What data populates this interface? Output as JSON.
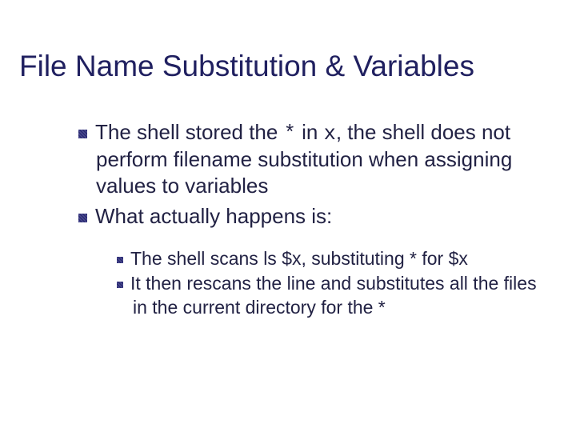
{
  "title": "File Name Substitution & Variables",
  "bullets": {
    "b1a": "The shell stored the ",
    "b1b": " in ",
    "b1c": ", the shell does not perform filename substitution when assigning values to variables",
    "b1_code1": "*",
    "b1_code2": "x",
    "b2": "What actually happens is:",
    "s1a": "The shell scans ls $x, substituting * for $x",
    "s2a": "It then rescans the line and substitutes all the files in the current directory for the *"
  }
}
